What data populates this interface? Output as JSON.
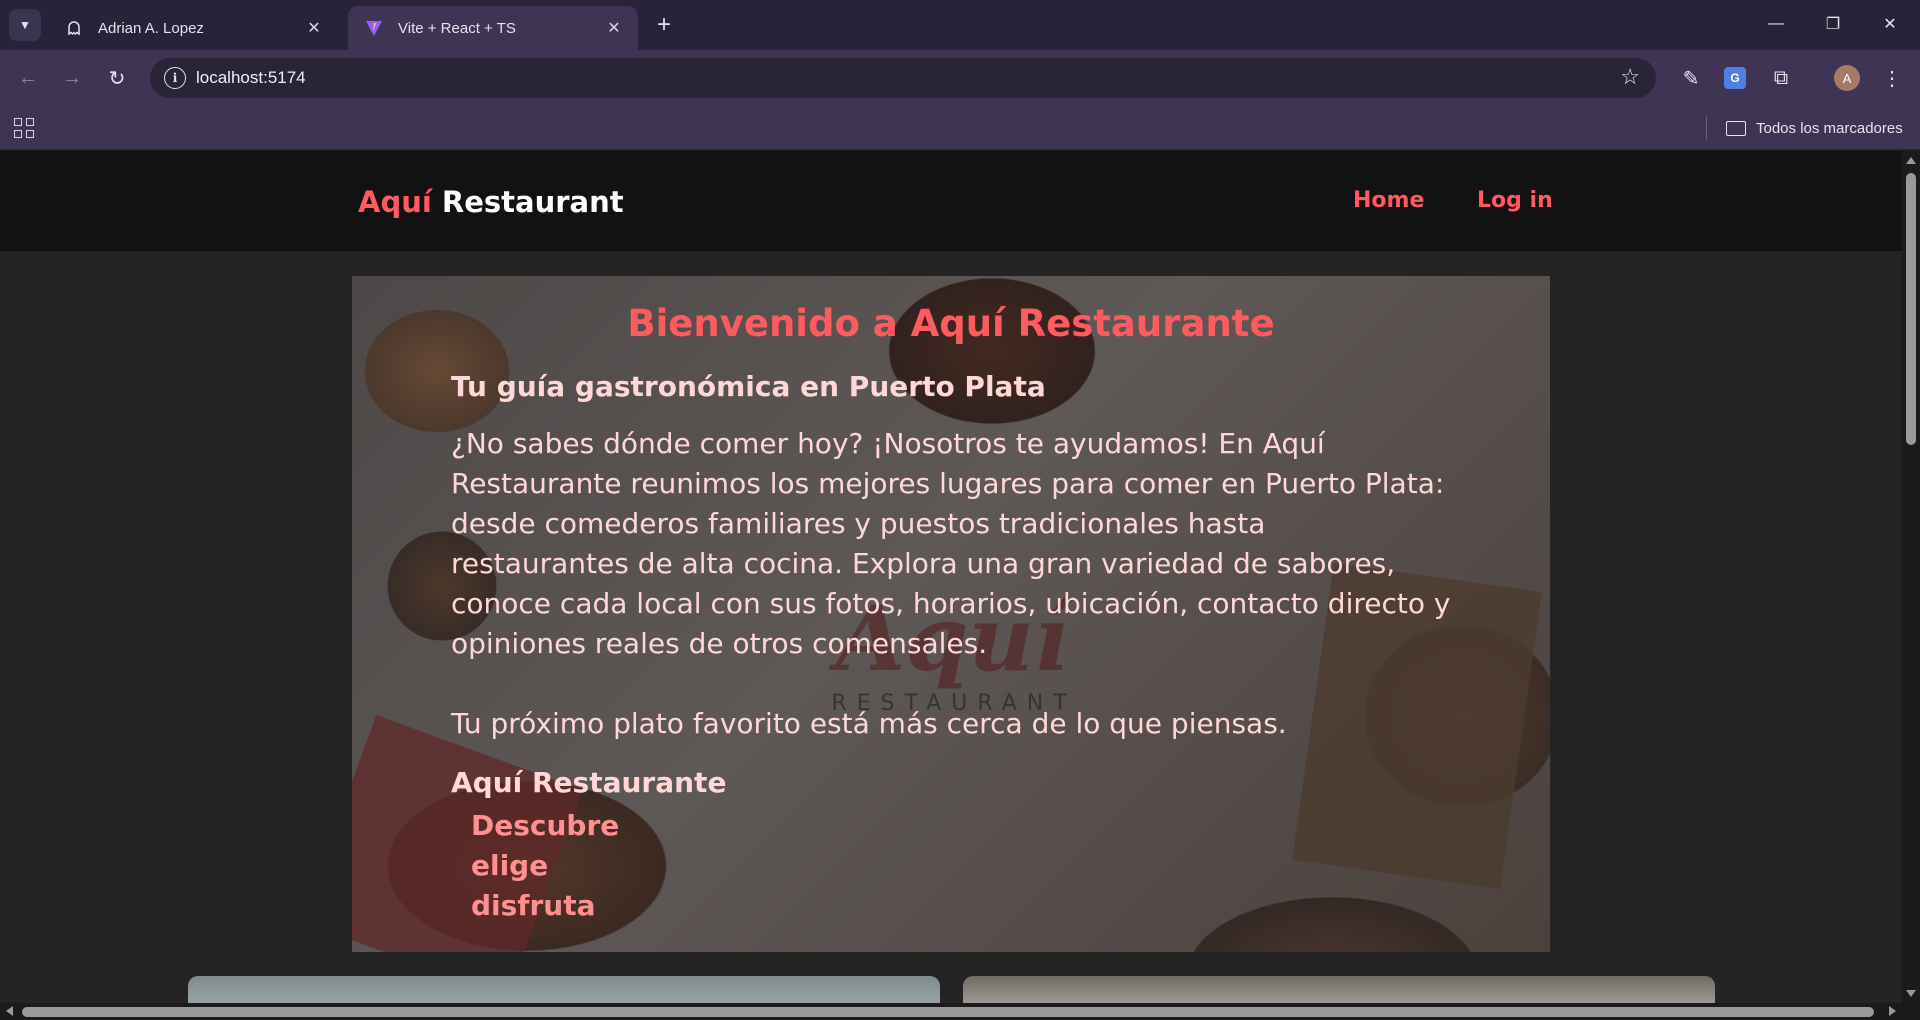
{
  "browser": {
    "tabs": [
      {
        "title": "Adrian A. Lopez",
        "icon": "ghost-icon",
        "active": false
      },
      {
        "title": "Vite + React + TS",
        "icon": "vite-icon",
        "active": true
      }
    ],
    "url": "localhost:5174",
    "profile_initial": "A",
    "bookmarks_label": "Todos los marcadores"
  },
  "site": {
    "brand_accent": "Aquí",
    "brand_rest": "Restaurant",
    "nav": [
      {
        "label": "Home"
      },
      {
        "label": "Log in"
      }
    ],
    "accent_color": "#ff5a5f"
  },
  "hero": {
    "title": "Bienvenido a Aquí Restaurante",
    "subtitle": "Tu guía gastronómica en Puerto Plata",
    "paragraph1": "¿No sabes dónde comer hoy? ¡Nosotros te ayudamos! En Aquí Restaurante reunimos los mejores lugares para comer en Puerto Plata: desde comederos familiares y puestos tradicionales hasta restaurantes de alta cocina. Explora una gran variedad de sabores, conoce cada local con sus fotos, horarios, ubicación, contacto directo y opiniones reales de otros comensales.",
    "paragraph2": "Tu próximo plato favorito está más cerca de lo que piensas.",
    "brand_line": "Aquí Restaurante",
    "list": [
      "Descubre",
      "elige",
      "disfruta"
    ],
    "watermark_logo": "Aquí",
    "watermark_sub": "RESTAURANT"
  }
}
